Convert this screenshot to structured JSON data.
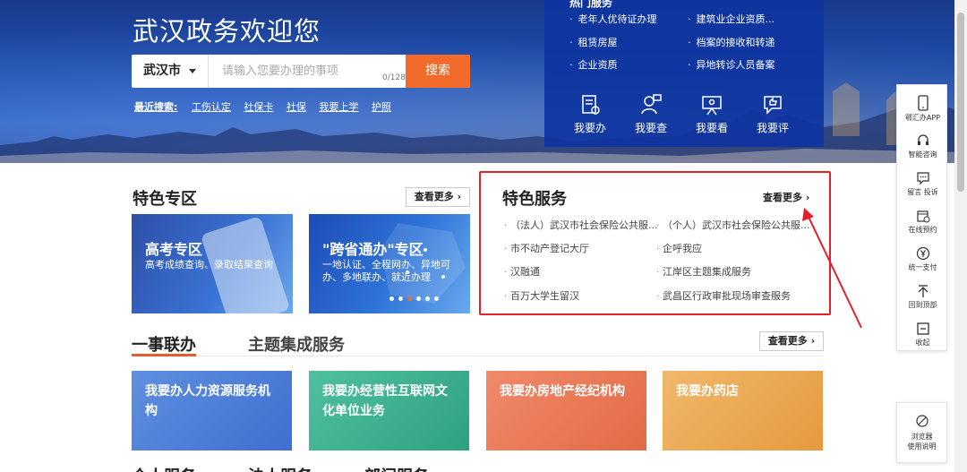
{
  "hero": {
    "title": "武汉政务欢迎您",
    "search": {
      "city": "武汉市",
      "placeholder": "请输入您要办理的事项",
      "counter": "0/128",
      "button": "搜索"
    },
    "recent_label": "最近搜索:",
    "recent_keywords": [
      "工伤认定",
      "社保卡",
      "社保",
      "我要上学",
      "护照"
    ]
  },
  "quick_panel": {
    "heading": "热门服务",
    "items": [
      "老年人优待证办理",
      "建筑业企业资质...",
      "租赁房屋",
      "档案的接收和转递",
      "企业资质",
      "异地转诊人员备案"
    ],
    "actions": [
      {
        "label": "我要办",
        "icon": "document-stamp-icon"
      },
      {
        "label": "我要查",
        "icon": "person-search-icon"
      },
      {
        "label": "我要看",
        "icon": "presentation-board-icon"
      },
      {
        "label": "我要评",
        "icon": "thumbs-up-chat-icon"
      }
    ]
  },
  "special_zone": {
    "title": "特色专区",
    "more": "查看更多 ›",
    "cards": [
      {
        "title": "高考专区",
        "subtitle": "高考成绩查询、录取结果查询"
      },
      {
        "title": "\"跨省通办\"专区",
        "subtitle": "一地认证、全程网办、异地可办、多地联办、就近办理"
      }
    ],
    "carousel_count": 6,
    "carousel_active": 3
  },
  "special_services": {
    "title": "特色服务",
    "more": "查看更多 ›",
    "items": [
      "（法人）武汉市社会保险公共服...",
      "（个人）武汉市社会保险公共服...",
      "市不动产登记大厅",
      "企呼我应",
      "汉融通",
      "江岸区主题集成服务",
      "百万大学生留汉",
      "武昌区行政审批现场审查服务"
    ]
  },
  "tabs": {
    "active": "一事联办",
    "inactive": "主题集成服务",
    "more": "查看更多 ›"
  },
  "tiles": [
    "我要办人力资源服务机构",
    "我要办经营性互联网文化单位业务",
    "我要办房地产经纪机构",
    "我要办药店"
  ],
  "next_section": [
    "个人服务",
    "法人服务",
    "部门服务"
  ],
  "sidebar": [
    {
      "label": "鄂汇办APP",
      "icon": "mobile-phone-icon"
    },
    {
      "label": "智能咨询",
      "icon": "headset-icon"
    },
    {
      "label": "留言 投诉",
      "icon": "chat-bubble-icon"
    },
    {
      "label": "在线预约",
      "icon": "calendar-clock-icon"
    },
    {
      "label": "统一支付",
      "icon": "yuan-icon"
    },
    {
      "label": "回到顶部",
      "icon": "arrow-up-icon"
    },
    {
      "label": "收起",
      "icon": "collapse-icon"
    }
  ],
  "browser_help": {
    "line1": "浏览器",
    "line2": "使用说明",
    "icon": "browser-icon"
  },
  "colors": {
    "accent_orange": "#f26b2a",
    "highlight_red": "#e4202a",
    "hero_blue": "#1d4fb0"
  }
}
